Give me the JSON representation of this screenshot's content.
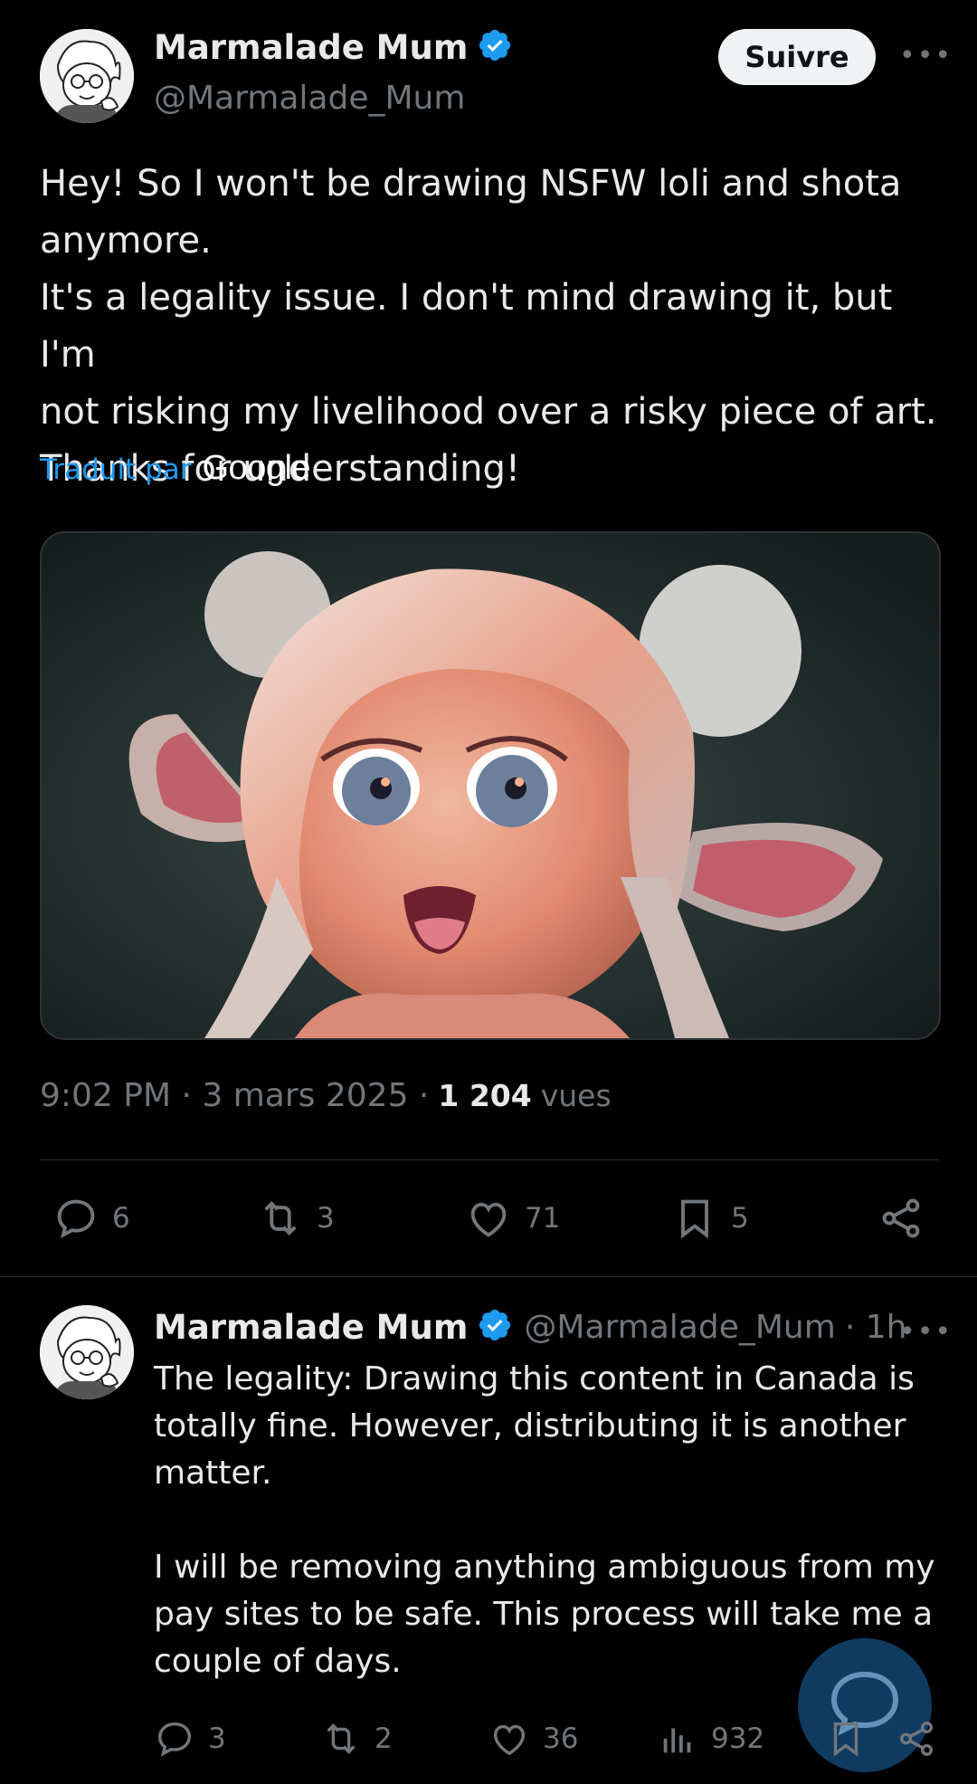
{
  "tweet": {
    "author_name": "Marmalade Mum",
    "author_handle": "@Marmalade_Mum",
    "follow_label": "Suivre",
    "more_label": "•••",
    "text": "Hey! So I won't be drawing NSFW loli and shota\nanymore.\nIt's a legality issue. I don't mind drawing it, but I'm\nnot risking my livelihood over a risky piece of art.\nThanks for understanding!",
    "translated_by": "Traduit par",
    "translator": "Google",
    "time": "9:02 PM · 3 mars 2025 ·",
    "views_count": "1 204",
    "views_label": "vues",
    "stats": {
      "replies": "6",
      "reposts": "3",
      "likes": "71",
      "bookmarks": "5"
    }
  },
  "reply": {
    "author_name": "Marmalade Mum",
    "author_handle": "@Marmalade_Mum",
    "time": "· 1h",
    "more_label": "•••",
    "text": "The legality: Drawing this content in Canada is\ntotally fine. However, distributing it is another\nmatter.\n\nI will be removing anything ambiguous from my\npay sites to be safe. This process will take me a\ncouple of days.",
    "stats": {
      "replies": "3",
      "reposts": "2",
      "likes": "36",
      "views": "932"
    }
  },
  "colors": {
    "background": "#000000",
    "text": "#e7e9ea",
    "muted": "#71767b",
    "accent": "#1d9bf0",
    "divider": "#2f3336"
  },
  "icons": [
    "verified-badge-icon",
    "reply-icon",
    "repost-icon",
    "like-icon",
    "bookmark-icon",
    "share-icon",
    "views-icon",
    "compose-icon"
  ]
}
